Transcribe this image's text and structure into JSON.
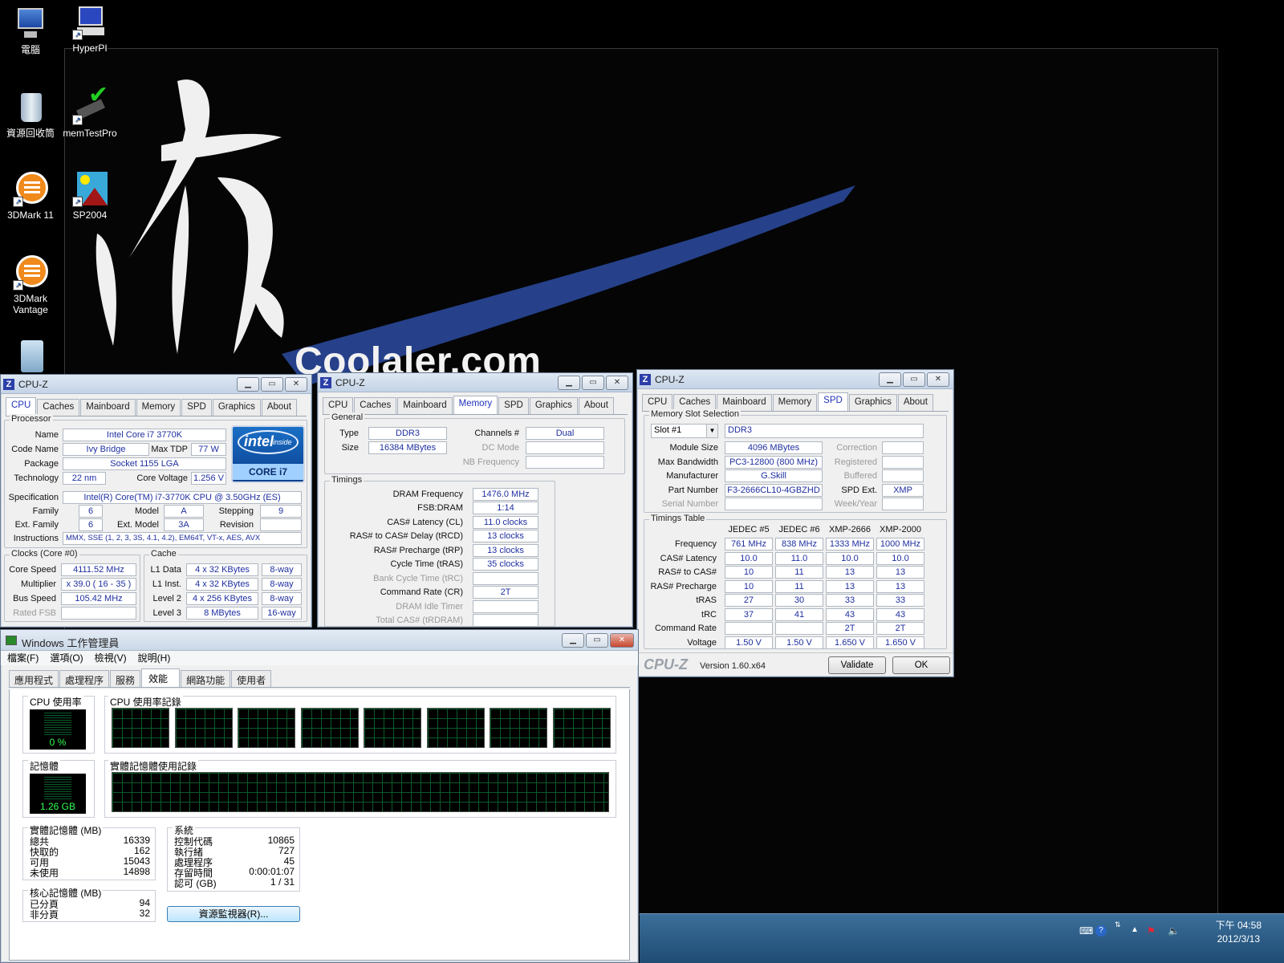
{
  "desktop": {
    "icons": [
      {
        "label": "電腦",
        "icon": "computer-icon"
      },
      {
        "label": "HyperPI",
        "icon": "hyperpi-icon"
      },
      {
        "label": "資源回收筒",
        "icon": "recycle-bin-icon"
      },
      {
        "label": "memTestPro",
        "icon": "memtestpro-icon"
      },
      {
        "label": "3DMark 11",
        "icon": "3dmark-icon"
      },
      {
        "label": "SP2004",
        "icon": "sp2004-icon"
      },
      {
        "label": "3DMark Vantage",
        "icon": "3dmark-vantage-icon"
      }
    ],
    "wallpaper_text": "Coolaler.com"
  },
  "cpuz_cpu": {
    "title": "CPU-Z",
    "tabs": [
      "CPU",
      "Caches",
      "Mainboard",
      "Memory",
      "SPD",
      "Graphics",
      "About"
    ],
    "active_tab": "CPU",
    "processor": {
      "group": "Processor",
      "name_label": "Name",
      "name": "Intel Core i7 3770K",
      "codename_label": "Code Name",
      "codename": "Ivy Bridge",
      "maxtdp_label": "Max TDP",
      "maxtdp": "77 W",
      "package_label": "Package",
      "package": "Socket 1155 LGA",
      "technology_label": "Technology",
      "technology": "22 nm",
      "voltage_label": "Core Voltage",
      "voltage": "1.256 V",
      "spec_label": "Specification",
      "spec": "Intel(R) Core(TM) i7-3770K CPU @ 3.50GHz (ES)",
      "family_label": "Family",
      "family": "6",
      "model_label": "Model",
      "model": "A",
      "stepping_label": "Stepping",
      "stepping": "9",
      "extfamily_label": "Ext. Family",
      "extfamily": "6",
      "extmodel_label": "Ext. Model",
      "extmodel": "3A",
      "revision_label": "Revision",
      "revision": "",
      "instructions_label": "Instructions",
      "instructions": "MMX, SSE (1, 2, 3, 3S, 4.1, 4.2), EM64T, VT-x, AES, AVX",
      "logo_inside": "intel inside",
      "logo_brand": "intel",
      "logo_model": "CORE i7"
    },
    "clocks": {
      "group": "Clocks (Core #0)",
      "corespeed_label": "Core Speed",
      "corespeed": "4111.52 MHz",
      "multiplier_label": "Multiplier",
      "multiplier": "x 39.0 ( 16 - 35 )",
      "busspeed_label": "Bus Speed",
      "busspeed": "105.42 MHz",
      "ratedfsb_label": "Rated FSB",
      "ratedfsb": ""
    },
    "cache": {
      "group": "Cache",
      "rows": [
        {
          "label": "L1 Data",
          "size": "4 x 32 KBytes",
          "way": "8-way"
        },
        {
          "label": "L1 Inst.",
          "size": "4 x 32 KBytes",
          "way": "8-way"
        },
        {
          "label": "Level 2",
          "size": "4 x 256 KBytes",
          "way": "8-way"
        },
        {
          "label": "Level 3",
          "size": "8 MBytes",
          "way": "16-way"
        }
      ]
    }
  },
  "cpuz_mem": {
    "title": "CPU-Z",
    "tabs": [
      "CPU",
      "Caches",
      "Mainboard",
      "Memory",
      "SPD",
      "Graphics",
      "About"
    ],
    "active_tab": "Memory",
    "general": {
      "group": "General",
      "type_label": "Type",
      "type": "DDR3",
      "size_label": "Size",
      "size": "16384 MBytes",
      "channels_label": "Channels #",
      "channels": "Dual",
      "dcmode_label": "DC Mode",
      "dcmode": "",
      "nbfreq_label": "NB Frequency",
      "nbfreq": ""
    },
    "timings": {
      "group": "Timings",
      "rows": [
        {
          "label": "DRAM Frequency",
          "value": "1476.0 MHz",
          "dim": false
        },
        {
          "label": "FSB:DRAM",
          "value": "1:14",
          "dim": false
        },
        {
          "label": "CAS# Latency (CL)",
          "value": "11.0 clocks",
          "dim": false
        },
        {
          "label": "RAS# to CAS# Delay (tRCD)",
          "value": "13 clocks",
          "dim": false
        },
        {
          "label": "RAS# Precharge (tRP)",
          "value": "13 clocks",
          "dim": false
        },
        {
          "label": "Cycle Time (tRAS)",
          "value": "35 clocks",
          "dim": false
        },
        {
          "label": "Bank Cycle Time (tRC)",
          "value": "",
          "dim": true
        },
        {
          "label": "Command Rate (CR)",
          "value": "2T",
          "dim": false
        },
        {
          "label": "DRAM Idle Timer",
          "value": "",
          "dim": true
        },
        {
          "label": "Total CAS# (tRDRAM)",
          "value": "",
          "dim": true
        }
      ]
    }
  },
  "cpuz_spd": {
    "title": "CPU-Z",
    "tabs": [
      "CPU",
      "Caches",
      "Mainboard",
      "Memory",
      "SPD",
      "Graphics",
      "About"
    ],
    "active_tab": "SPD",
    "slot": {
      "group": "Memory Slot Selection",
      "slot_select": "Slot #1",
      "slot_type": "DDR3",
      "modulesize_label": "Module Size",
      "modulesize": "4096 MBytes",
      "maxbw_label": "Max Bandwidth",
      "maxbw": "PC3-12800 (800 MHz)",
      "manufacturer_label": "Manufacturer",
      "manufacturer": "G.Skill",
      "partnumber_label": "Part Number",
      "partnumber": "F3-2666CL10-4GBZHD",
      "serial_label": "Serial Number",
      "serial": "",
      "correction_label": "Correction",
      "correction": "",
      "registered_label": "Registered",
      "registered": "",
      "buffered_label": "Buffered",
      "buffered": "",
      "spdext_label": "SPD Ext.",
      "spdext": "XMP",
      "weekyear_label": "Week/Year",
      "weekyear": ""
    },
    "timings_table": {
      "group": "Timings Table",
      "columns": [
        "JEDEC #5",
        "JEDEC #6",
        "XMP-2666",
        "XMP-2000"
      ],
      "rows": [
        {
          "label": "Frequency",
          "values": [
            "761 MHz",
            "838 MHz",
            "1333 MHz",
            "1000 MHz"
          ]
        },
        {
          "label": "CAS# Latency",
          "values": [
            "10.0",
            "11.0",
            "10.0",
            "10.0"
          ]
        },
        {
          "label": "RAS# to CAS#",
          "values": [
            "10",
            "11",
            "13",
            "13"
          ]
        },
        {
          "label": "RAS# Precharge",
          "values": [
            "10",
            "11",
            "13",
            "13"
          ]
        },
        {
          "label": "tRAS",
          "values": [
            "27",
            "30",
            "33",
            "33"
          ]
        },
        {
          "label": "tRC",
          "values": [
            "37",
            "41",
            "43",
            "43"
          ]
        },
        {
          "label": "Command Rate",
          "values": [
            "",
            "",
            "2T",
            "2T"
          ]
        },
        {
          "label": "Voltage",
          "values": [
            "1.50 V",
            "1.50 V",
            "1.650 V",
            "1.650 V"
          ]
        }
      ]
    },
    "footer": {
      "brand": "CPU-Z",
      "version": "Version 1.60.x64",
      "validate": "Validate",
      "ok": "OK"
    }
  },
  "taskmgr": {
    "title": "Windows 工作管理員",
    "menu": [
      "檔案(F)",
      "選項(O)",
      "檢視(V)",
      "說明(H)"
    ],
    "tabs": [
      "應用程式",
      "處理程序",
      "服務",
      "效能",
      "網路功能",
      "使用者"
    ],
    "active_tab": "效能",
    "cpu_usage_label": "CPU 使用率",
    "cpu_usage": "0 %",
    "cpu_history_label": "CPU 使用率記錄",
    "mem_label": "記憶體",
    "mem_value": "1.26 GB",
    "mem_history_label": "實體記憶體使用記錄",
    "physical": {
      "title": "實體記憶體 (MB)",
      "rows": [
        {
          "label": "總共",
          "value": "16339"
        },
        {
          "label": "快取的",
          "value": "162"
        },
        {
          "label": "可用",
          "value": "15043"
        },
        {
          "label": "未使用",
          "value": "14898"
        }
      ]
    },
    "kernel": {
      "title": "核心記憶體 (MB)",
      "rows": [
        {
          "label": "已分頁",
          "value": "94"
        },
        {
          "label": "非分頁",
          "value": "32"
        }
      ]
    },
    "system": {
      "title": "系統",
      "rows": [
        {
          "label": "控制代碼",
          "value": "10865"
        },
        {
          "label": "執行緒",
          "value": "727"
        },
        {
          "label": "處理程序",
          "value": "45"
        },
        {
          "label": "存留時間",
          "value": "0:00:01:07"
        },
        {
          "label": "認可 (GB)",
          "value": "1 / 31"
        }
      ]
    },
    "resource_monitor": "資源監視器(R)..."
  },
  "taskbar": {
    "time": "下午 04:58",
    "date": "2012/3/13"
  }
}
